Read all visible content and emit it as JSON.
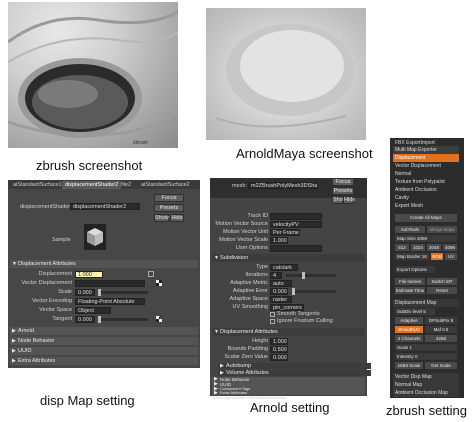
{
  "captions": {
    "zbrush_screenshot": "zbrush screenshot",
    "arnold_maya_screenshot": "ArnoldMaya screenshot",
    "disp_map_setting": "disp Map setting",
    "arnold_setting": "Arnold setting",
    "zbrush_setting": "zbrush setting"
  },
  "zbrush_image": {
    "overlay_text": "zbrush"
  },
  "disp_panel": {
    "tabs": [
      "aiStandardSurface16S",
      "displacementShader2",
      "file2",
      "aiStandardSurface2"
    ],
    "shader_label": "displacementShader:",
    "shader_value": "displacementShader2",
    "focus": "Focus",
    "presets": "Presets",
    "show": "Show",
    "hide": "Hide",
    "sample_label": "Sample",
    "section_displacement": "Displacement Attributes",
    "rows": [
      {
        "label": "Displacement",
        "value": "1.000"
      },
      {
        "label": "Vector Displacement",
        "value": ""
      },
      {
        "label": "Scale",
        "value": "0.000"
      },
      {
        "label": "Vector Encoding",
        "value": "Floating-Point Absolute"
      },
      {
        "label": "Vector Space",
        "value": "Object"
      },
      {
        "label": "Tangent",
        "value": "0.000"
      }
    ],
    "sections": [
      "Arnold",
      "Node Behavior",
      "UUID",
      "Extra Attributes"
    ]
  },
  "arnold_panel": {
    "mesh_label": "mesh:",
    "mesh_value": "m2ZBrushPolyMesh3DShape",
    "focus": "Focus",
    "presets": "Presets",
    "show": "Show",
    "hide": "Hide",
    "top_rows": [
      {
        "label": "Track ID",
        "value": ""
      },
      {
        "label": "Motion Vector Source",
        "value": "velocityPV"
      },
      {
        "label": "Motion Vector Unit",
        "value": "Per Frame"
      },
      {
        "label": "Motion Vector Scale",
        "value": "1.000"
      },
      {
        "label": "User Options",
        "value": ""
      }
    ],
    "subdivision_section": "Subdivision",
    "subdiv_rows": [
      {
        "label": "Type",
        "value": "catclark"
      },
      {
        "label": "Iterations",
        "value": "4"
      },
      {
        "label": "Adaptive Metric",
        "value": "auto"
      },
      {
        "label": "Adaptive Error",
        "value": "0.000"
      },
      {
        "label": "Adaptive Space",
        "value": "raster"
      },
      {
        "label": "UV Smoothing",
        "value": "pin_corners"
      }
    ],
    "checks": [
      "Smooth Tangents",
      "Ignore Frustum Culling"
    ],
    "displacement_section": "Displacement Attributes",
    "disp_rows": [
      {
        "label": "Height",
        "value": "1.000"
      },
      {
        "label": "Bounds Padding",
        "value": "0.500"
      },
      {
        "label": "Scalar Zero Value",
        "value": "0.000"
      }
    ],
    "sub_sections": [
      "Autobump",
      "Volume Attributes"
    ],
    "lower_sections": [
      "Node Behavior",
      "UUID",
      "Component Tags",
      "Extra Attributes"
    ],
    "notes": "Notes:  ppmsh2ZBrushPolyMesh3DShape"
  },
  "zb_panel": {
    "header": "FBX ExportImport",
    "multi_map": "Multi Map Exporter",
    "items": [
      "Displacement",
      "Vector Displacement",
      "Normal",
      "Texture from Polypaint",
      "Ambient Occlusion",
      "Cavity",
      "Export Mesh"
    ],
    "create_all": "Create All Maps",
    "subtools": "SubTools",
    "merge_maps": "Merge Maps",
    "map_size": "Map Size 4096",
    "sizes": [
      "512",
      "1024",
      "2048",
      "4096"
    ],
    "map_border": "Map Border 16",
    "rgb": "RGB",
    "uv": "UV",
    "export_options": "Export Options",
    "file_names": "File names",
    "switch_mt": "Switch MT",
    "estimate_time": "Estimate Time",
    "reset": "Reset",
    "disp_map": "Displacement Map",
    "subdiv_level": "SubDiv level 5",
    "adaptive": "Adaptive",
    "dpsubpix": "DPSubPix 8",
    "smoothuv": "SmoothUV",
    "mid": "Mid 0.5",
    "channels": "3 Channels",
    "bits": "32Bit",
    "scale": "Scale 1",
    "intensity": "Intensity 0",
    "bit16": "16Bit Scale",
    "get_scale": "Get Scale",
    "vector_disp": "Vector Disp Map",
    "normal_map": "Normal Map",
    "ambient": "Ambient Occlusion Map"
  }
}
